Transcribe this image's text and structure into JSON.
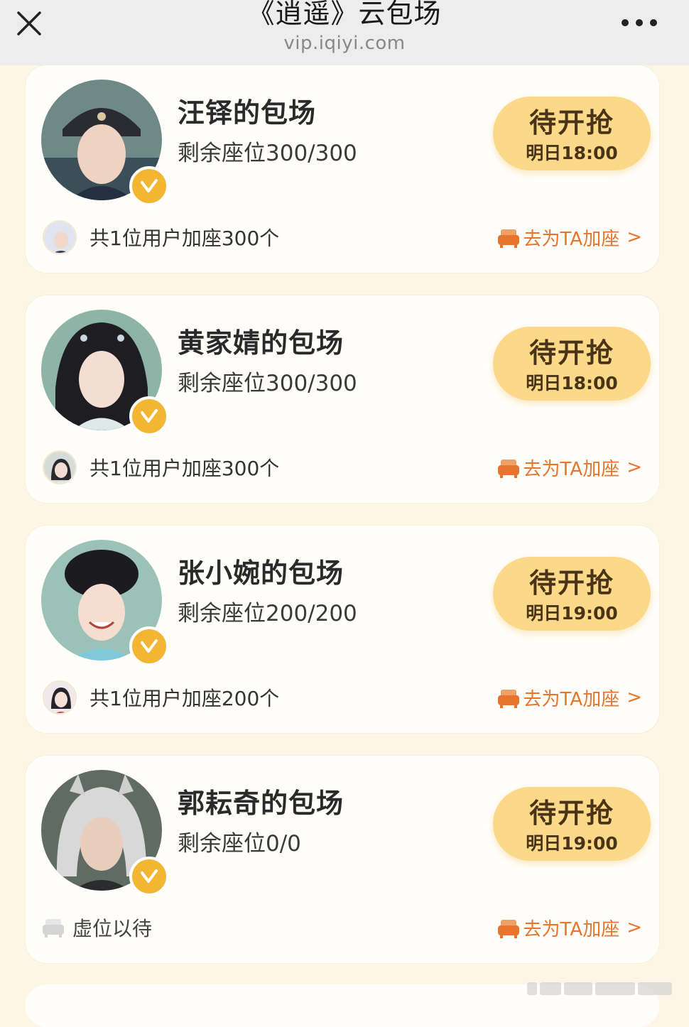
{
  "header": {
    "title": "《逍遥》云包场",
    "url": "vip.iqiyi.com"
  },
  "colors": {
    "page_bg": "#fdf6e6",
    "card_bg": "#fffefb",
    "button_bg": "#fcd889",
    "accent_orange": "#e8752c",
    "verified_badge": "#f2b632"
  },
  "cards": [
    {
      "title": "汪铎的包场",
      "seats": "剩余座位300/300",
      "button_label": "待开抢",
      "button_time": "明日18:00",
      "footer_text": "共1位用户加座300个",
      "add_link": "去为TA加座",
      "chevron": ">"
    },
    {
      "title": "黄家婧的包场",
      "seats": "剩余座位300/300",
      "button_label": "待开抢",
      "button_time": "明日18:00",
      "footer_text": "共1位用户加座300个",
      "add_link": "去为TA加座",
      "chevron": ">"
    },
    {
      "title": "张小婉的包场",
      "seats": "剩余座位200/200",
      "button_label": "待开抢",
      "button_time": "明日19:00",
      "footer_text": "共1位用户加座200个",
      "add_link": "去为TA加座",
      "chevron": ">"
    },
    {
      "title": "郭耘奇的包场",
      "seats": "剩余座位0/0",
      "button_label": "待开抢",
      "button_time": "明日19:00",
      "footer_text": "虚位以待",
      "add_link": "去为TA加座",
      "chevron": ">"
    }
  ]
}
